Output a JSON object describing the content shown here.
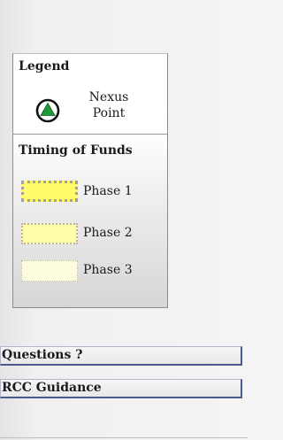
{
  "legend": {
    "title": "Legend",
    "nexus": {
      "icon": "nexus-point-icon",
      "label_line1": "Nexus",
      "label_line2": "Point",
      "color": "#1e9a3a"
    }
  },
  "timing": {
    "title": "Timing of Funds",
    "phases": [
      {
        "label": "Phase 1",
        "color": "#fffb6a"
      },
      {
        "label": "Phase 2",
        "color": "#fffcaa"
      },
      {
        "label": "Phase 3",
        "color": "#fffde0"
      }
    ]
  },
  "buttons": {
    "questions": "Questions ?",
    "rcc_guidance": "RCC Guidance"
  }
}
